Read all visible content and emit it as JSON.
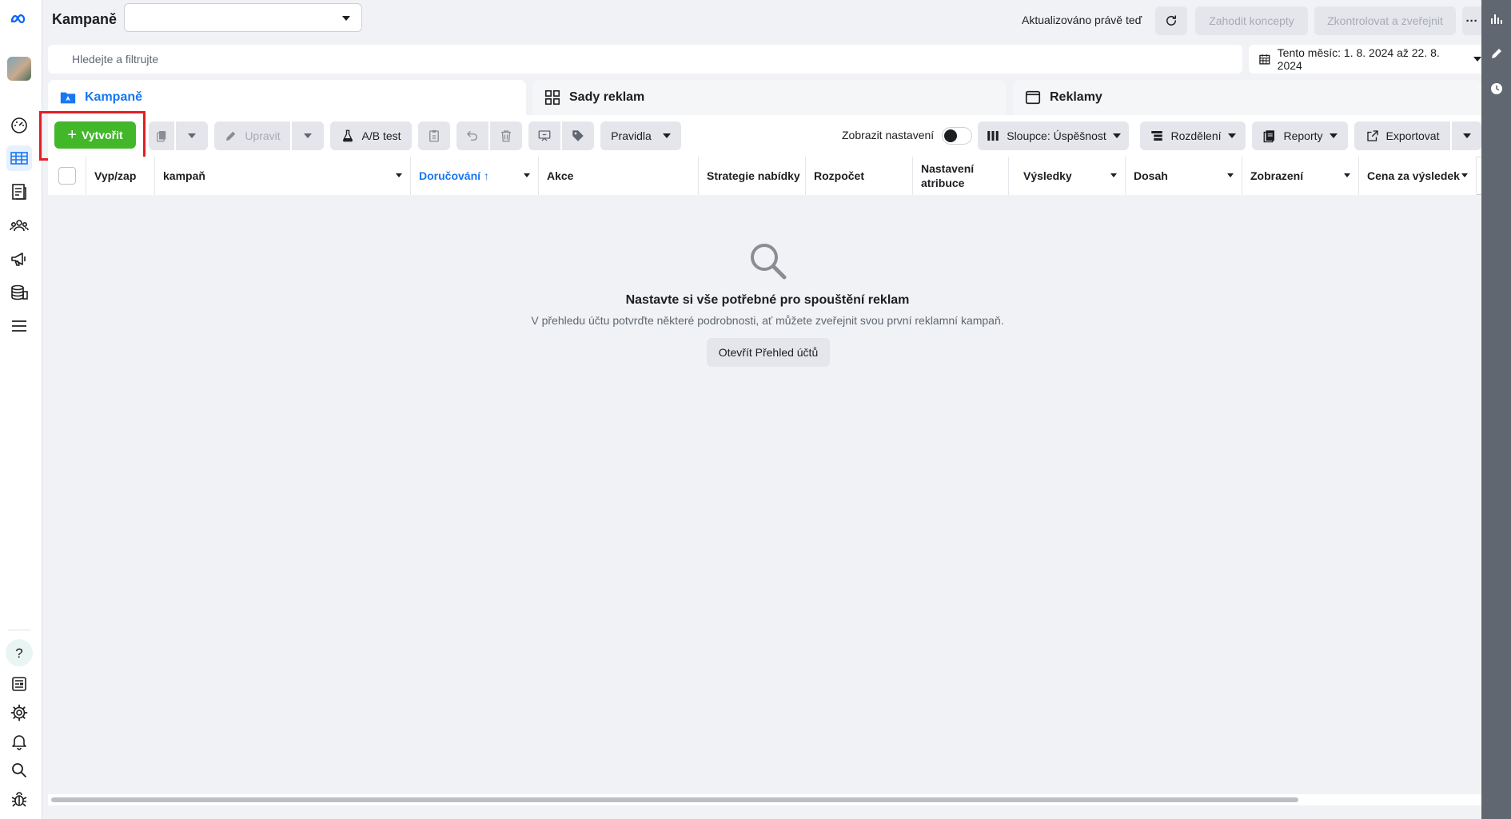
{
  "header": {
    "title": "Kampaně",
    "dropdown_value": "",
    "updated_text": "Aktualizováno právě teď",
    "discard_label": "Zahodit koncepty",
    "review_label": "Zkontrolovat a zveřejnit",
    "more_label": "···"
  },
  "search": {
    "placeholder": "Hledejte a filtrujte"
  },
  "date_range": {
    "label": "Tento měsíc: 1. 8. 2024 až 22. 8. 2024"
  },
  "tabs": [
    {
      "label": "Kampaně"
    },
    {
      "label": "Sady reklam"
    },
    {
      "label": "Reklamy"
    }
  ],
  "toolbar": {
    "create_label": "Vytvořit",
    "edit_label": "Upravit",
    "ab_test_label": "A/B test",
    "rules_label": "Pravidla",
    "show_settings_label": "Zobrazit nastavení",
    "columns_label": "Sloupce: Úspěšnost",
    "breakdown_label": "Rozdělení",
    "reports_label": "Reporty",
    "export_label": "Exportovat"
  },
  "table": {
    "columns": [
      {
        "label": "Vyp/zap"
      },
      {
        "label": "kampaň"
      },
      {
        "label": "Doručování ↑"
      },
      {
        "label": "Akce"
      },
      {
        "label": "Strategie nabídky"
      },
      {
        "label": "Rozpočet"
      },
      {
        "label": "Nastavení atribuce"
      },
      {
        "label": "Výsledky"
      },
      {
        "label": "Dosah"
      },
      {
        "label": "Zobrazení"
      },
      {
        "label": "Cena za výsledek"
      }
    ]
  },
  "empty_state": {
    "title": "Nastavte si vše potřebné pro spouštění reklam",
    "description": "V přehledu účtu potvrďte některé podrobnosti, ať můžete zveřejnit svou první reklamní kampaň.",
    "button_label": "Otevřít Přehled účtů"
  },
  "icons": {
    "nav": [
      "meta-logo-icon",
      "avatar",
      "dashboard-icon",
      "campaigns-table-icon",
      "catalog-icon",
      "audiences-icon",
      "megaphone-icon",
      "billing-icon",
      "menu-icon",
      "help-icon",
      "news-icon",
      "settings-icon",
      "bell-icon",
      "search-icon",
      "bug-icon"
    ]
  },
  "colors": {
    "accent": "#1877f2",
    "create_button": "#42b72a",
    "highlight_box": "#e41e26",
    "right_rail": "#606770"
  }
}
